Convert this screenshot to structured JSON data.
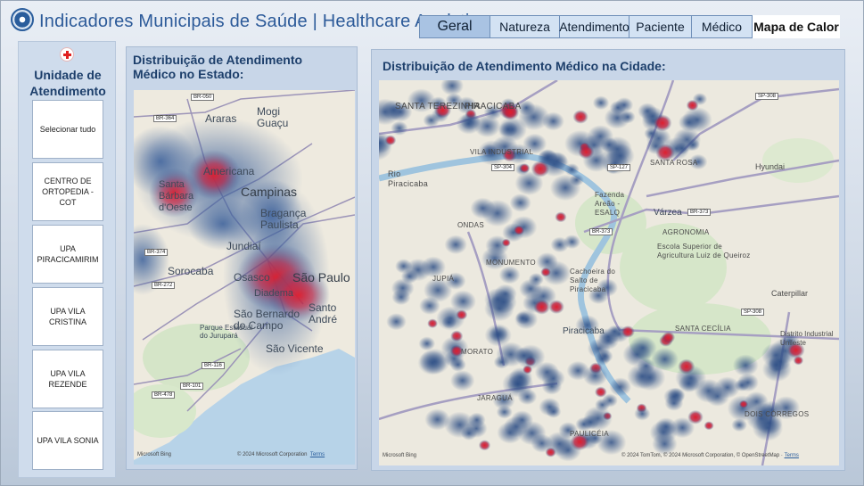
{
  "header": {
    "title": "Indicadores Municipais de Saúde | Healthcare Analytics",
    "tabs": [
      "Geral",
      "Natureza",
      "Atendimento",
      "Paciente",
      "Médico",
      "Mapa de Calor"
    ],
    "active_tab": "Mapa de Calor"
  },
  "sidebar": {
    "title": "Unidade de Atendimento",
    "items": [
      {
        "label": "Selecionar tudo"
      },
      {
        "label": "CENTRO DE ORTOPEDIA - COT"
      },
      {
        "label": "UPA PIRACICAMIRIM"
      },
      {
        "label": "UPA VILA CRISTINA"
      },
      {
        "label": "UPA VILA REZENDE"
      },
      {
        "label": "UPA VILA SONIA"
      }
    ]
  },
  "state_map": {
    "title": "Distribuição de Atendimento Médico no Estado:",
    "labels": [
      "Araras",
      "Mogi Guaçu",
      "Americana",
      "Santa Bárbara d'Oeste",
      "Campinas",
      "Bragança Paulista",
      "Jundiaí",
      "Sorocaba",
      "Osasco",
      "São Paulo",
      "Diadema",
      "Santo André",
      "São Bernardo do Campo",
      "Parque Estadual do Jurupará",
      "São Vicente"
    ],
    "shields": [
      "BR-050",
      "BR-364",
      "BR-374",
      "BR-272",
      "BR-116",
      "BR-101",
      "BR-478"
    ],
    "bing": "Microsoft Bing",
    "copyright": "© 2024 Microsoft Corporation",
    "terms": "Terms"
  },
  "city_map": {
    "title": "Distribuição de Atendimento Médico na Cidade:",
    "labels": [
      "SANTA TEREZINHA",
      "PIRACICABA",
      "VILA INDUSTRIAL",
      "Rio Piracicaba",
      "ONDAS",
      "AGRONOMIA",
      "SANTA ROSA",
      "Hyundai",
      "Várzea",
      "Fazenda Areão - ESALQ",
      "Escola Superior de Agricultura Luiz de Queiroz",
      "MONUMENTO",
      "Cachoeira do Salto de Piracicaba",
      "JUPIÁ",
      "Piracicaba",
      "Caterpillar",
      "SANTA CECÍLIA",
      "Distrito Industrial Unileste",
      "MORATO",
      "DOIS CÓRREGOS",
      "PAULICÉIA",
      "JARAGUÁ"
    ],
    "shields": [
      "SP-308",
      "SP-127",
      "SP-304",
      "BR-373",
      "BR-373",
      "SP-308"
    ],
    "bing": "Microsoft Bing",
    "copyright": "© 2024 TomTom, © 2024 Microsoft Corporation, © OpenStreetMap",
    "terms": "Terms"
  },
  "colors": {
    "accent": "#2c5a99",
    "heat_low": "#3a5f9a",
    "heat_high": "#e01e2e"
  }
}
